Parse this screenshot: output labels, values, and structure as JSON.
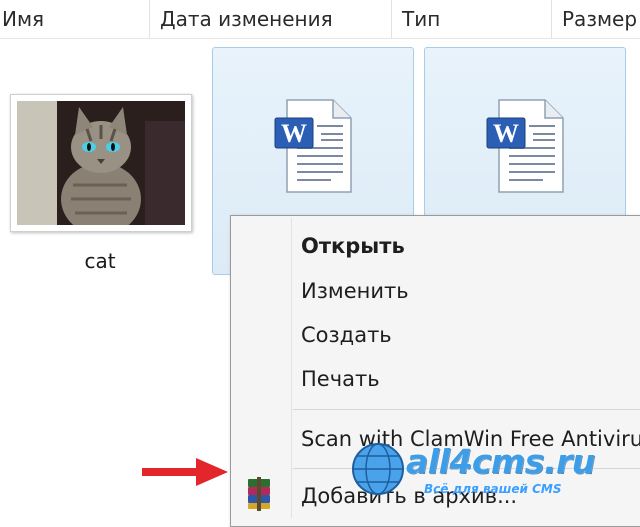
{
  "columns": {
    "name": "Имя",
    "date": "Дата изменения",
    "type": "Тип",
    "size": "Размер"
  },
  "files": [
    {
      "label": "cat",
      "icon": "image-thumbnail",
      "selected": false
    },
    {
      "label": "",
      "icon": "word-document-icon",
      "selected": true
    },
    {
      "label": "",
      "icon": "word-document-icon",
      "selected": true
    }
  ],
  "context_menu": {
    "items": [
      {
        "label": "Открыть",
        "bold": true
      },
      {
        "label": "Изменить"
      },
      {
        "label": "Создать"
      },
      {
        "label": "Печать"
      },
      {
        "label": "Scan with ClamWin Free Antivirus"
      },
      {
        "label": "Добавить в архив...",
        "icon": "winrar-icon"
      }
    ]
  },
  "annotation": {
    "arrow_color": "#e3262b"
  },
  "watermark": {
    "text": "all4cms.ru",
    "subtext": "Всё для вашей CMS"
  },
  "colors": {
    "selection_fill": "#dcebf7",
    "selection_border": "#a9cde8",
    "menu_bg": "#f5f5f5",
    "watermark": "#3d9de6"
  }
}
